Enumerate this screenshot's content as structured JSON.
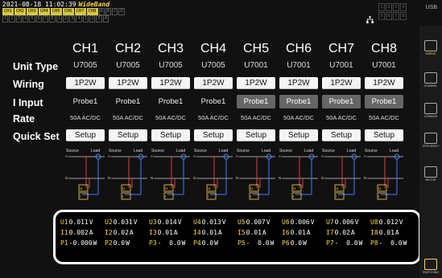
{
  "status": {
    "datetime": "2021-08-18 11:02:39",
    "mode": "WideBand",
    "channels_row1": [
      "CH1",
      "CH2",
      "CH3",
      "CH4",
      "CH5",
      "CH6",
      "CH7",
      "CH8",
      "A",
      "B",
      "C",
      "D"
    ],
    "channels_row2": [
      "1",
      "2",
      "3",
      "4",
      "5",
      "6",
      "7",
      "8",
      "1",
      "2",
      "3",
      "4",
      "1",
      "2",
      "3",
      "4"
    ],
    "usb": "USB",
    "grid": [
      "1",
      "2",
      "3",
      "4",
      "5",
      "6",
      "7",
      "8"
    ]
  },
  "labels": {
    "unit_type": "Unit Type",
    "wiring": "Wiring",
    "i_input": "I Input",
    "rate": "Rate",
    "quick_set": "Quick Set"
  },
  "channels": [
    {
      "name": "CH1",
      "unit": "U7005",
      "wiring": "1P2W",
      "probe": "Probe1",
      "rate": "50A AC/DC",
      "setup": "Setup"
    },
    {
      "name": "CH2",
      "unit": "U7005",
      "wiring": "1P2W",
      "probe": "Probe1",
      "rate": "50A AC/DC",
      "setup": "Setup"
    },
    {
      "name": "CH3",
      "unit": "U7005",
      "wiring": "1P2W",
      "probe": "Probe1",
      "rate": "50A AC/DC",
      "setup": "Setup"
    },
    {
      "name": "CH4",
      "unit": "U7005",
      "wiring": "1P2W",
      "probe": "Probe1",
      "rate": "50A AC/DC",
      "setup": "Setup"
    },
    {
      "name": "CH5",
      "unit": "U7001",
      "wiring": "1P2W",
      "probe": "Probe1",
      "rate": "50A AC/DC",
      "setup": "Setup"
    },
    {
      "name": "CH6",
      "unit": "U7001",
      "wiring": "1P2W",
      "probe": "Probe1",
      "rate": "50A AC/DC",
      "setup": "Setup"
    },
    {
      "name": "CH7",
      "unit": "U7001",
      "wiring": "1P2W",
      "probe": "Probe1",
      "rate": "50A AC/DC",
      "setup": "Setup"
    },
    {
      "name": "CH8",
      "unit": "U7001",
      "wiring": "1P2W",
      "probe": "Probe1",
      "rate": "50A AC/DC",
      "setup": "Setup"
    }
  ],
  "diagram_labels": {
    "source": "Source",
    "load": "Load",
    "a": "A",
    "n": "N",
    "uo": "U",
    "io": "I"
  },
  "readout": {
    "u": [
      {
        "tag": "U1",
        "val": "0.011",
        "unit": "V"
      },
      {
        "tag": "U2",
        "val": "0.031",
        "unit": "V"
      },
      {
        "tag": "U3",
        "val": "0.014",
        "unit": "V"
      },
      {
        "tag": "U4",
        "val": "0.013",
        "unit": "V"
      },
      {
        "tag": "U5",
        "val": "0.007",
        "unit": "V"
      },
      {
        "tag": "U6",
        "val": "0.006",
        "unit": "V"
      },
      {
        "tag": "U7",
        "val": "0.006",
        "unit": "V"
      },
      {
        "tag": "U8",
        "val": "0.012",
        "unit": "V"
      }
    ],
    "i": [
      {
        "tag": "I1",
        "val": "0.002",
        "unit": "A"
      },
      {
        "tag": "I2",
        "val": "0.02",
        "unit": "A"
      },
      {
        "tag": "I3",
        "val": "0.01",
        "unit": "A"
      },
      {
        "tag": "I4",
        "val": "0.01",
        "unit": "A"
      },
      {
        "tag": "I5",
        "val": "0.01",
        "unit": "A"
      },
      {
        "tag": "I6",
        "val": "0.01",
        "unit": "A"
      },
      {
        "tag": "I7",
        "val": "0.02",
        "unit": "A"
      },
      {
        "tag": "I8",
        "val": "0.01",
        "unit": "A"
      }
    ],
    "p": [
      {
        "tag": "P1",
        "val": "-0.000",
        "unit": "W"
      },
      {
        "tag": "P2",
        "val": "0.0",
        "unit": "W"
      },
      {
        "tag": "P3",
        "val": "-  0.0",
        "unit": "W"
      },
      {
        "tag": "P4",
        "val": "0.0",
        "unit": "W"
      },
      {
        "tag": "P5",
        "val": "-  0.0",
        "unit": "W"
      },
      {
        "tag": "P6",
        "val": "0.0",
        "unit": "W"
      },
      {
        "tag": "P7",
        "val": "-  0.0",
        "unit": "W"
      },
      {
        "tag": "P8",
        "val": "-  0.0",
        "unit": "W"
      }
    ]
  },
  "right_panel": [
    "WIRING",
    "CHANNEL",
    "COMMON",
    "EFFICIENCY",
    "MOTOR",
    "SWITCHING"
  ],
  "colors": {
    "accent": "#ffd54a",
    "button": "#f4f4f4",
    "probe_active": "#666666",
    "voltage": "#e04040",
    "current": "#4080ff"
  }
}
